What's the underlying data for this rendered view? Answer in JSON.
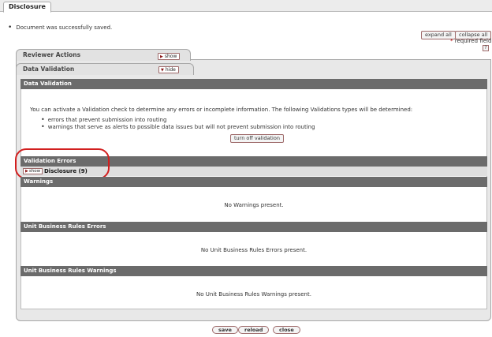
{
  "top_tab": {
    "label": "Disclosure"
  },
  "messages": [
    "Document was successfully saved."
  ],
  "controls": {
    "expand_all": "expand all",
    "collapse_all": "collapse all",
    "required_star": "*",
    "required_text": " required field",
    "help_glyph": "?"
  },
  "tabs": {
    "reviewer_actions": {
      "title": "Reviewer Actions",
      "toggle": "show"
    },
    "data_validation": {
      "title": "Data Validation",
      "toggle": "hide"
    }
  },
  "data_validation": {
    "header": "Data Validation",
    "intro": "You can activate a Validation check to determine any errors or incomplete information. The following Validations types will be determined:",
    "bullets": [
      "errors that prevent submission into routing",
      "warnings that serve as alerts to possible data issues but will not prevent submission into routing"
    ],
    "turn_off_button": "turn off validation"
  },
  "validation_errors": {
    "header": "Validation Errors",
    "show_button": "show",
    "disclosure_label": "Disclosure (9)"
  },
  "warnings": {
    "header": "Warnings",
    "message": "No Warnings present."
  },
  "unit_business_rules_errors": {
    "header": "Unit Business Rules Errors",
    "message": "No Unit Business Rules Errors present."
  },
  "unit_business_rules_warnings": {
    "header": "Unit Business Rules Warnings",
    "message": "No Unit Business Rules Warnings present."
  },
  "footer_buttons": {
    "save": "save",
    "reload": "reload",
    "close": "close"
  },
  "colors": {
    "section_bar": "#6b6b6b",
    "highlight": "#d21f1f",
    "button_border": "#9e6a6a"
  }
}
